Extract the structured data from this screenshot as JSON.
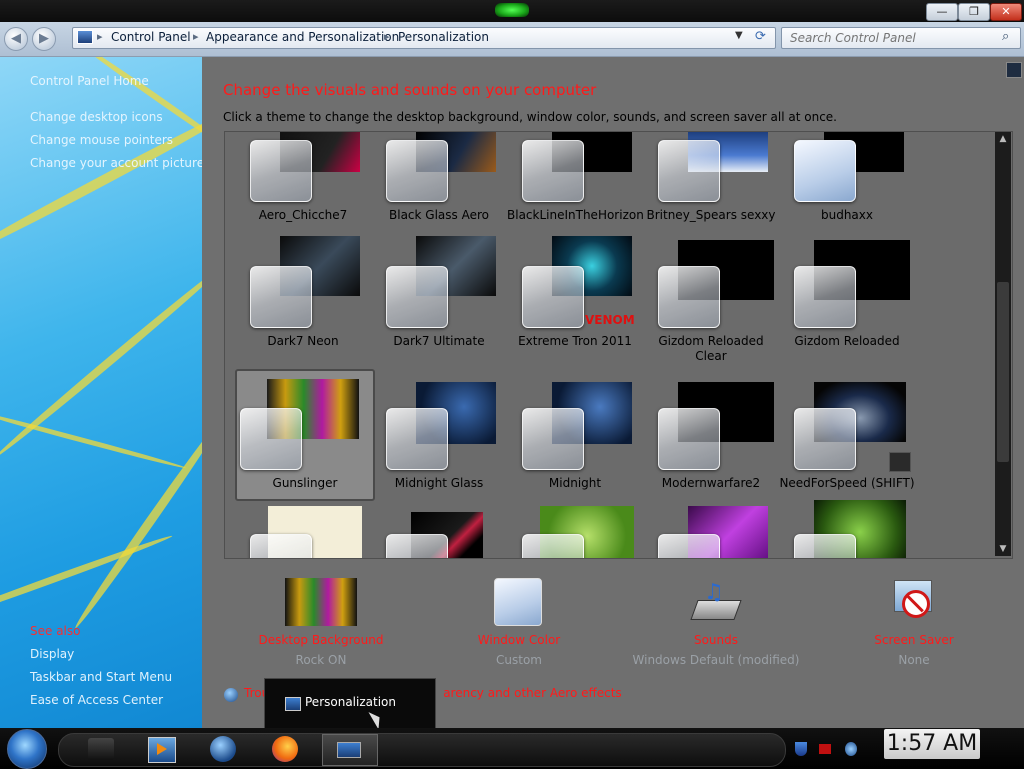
{
  "window": {
    "minimize": "—",
    "restore": "❐",
    "close": "✕"
  },
  "nav": {
    "back": "◀",
    "forward": "▶",
    "breadcrumbs": [
      "Control Panel",
      "Appearance and Personalization",
      "Personalization"
    ],
    "search_placeholder": "Search Control Panel"
  },
  "sidebar": {
    "home": "Control Panel Home",
    "links": [
      "Change desktop icons",
      "Change mouse pointers",
      "Change your account picture"
    ],
    "see_also_title": "See also",
    "see_also": [
      "Display",
      "Taskbar and Start Menu",
      "Ease of Access Center"
    ]
  },
  "main": {
    "title": "Change the visuals and sounds on your computer",
    "subtitle": "Click a theme to change the desktop background, window color, sounds, and screen saver all at once."
  },
  "themes": [
    {
      "name": "Aero_Chicche7"
    },
    {
      "name": "Black Glass Aero"
    },
    {
      "name": "BlackLineInTheHorizon"
    },
    {
      "name": "Britney_Spears sexxy"
    },
    {
      "name": "budhaxx"
    },
    {
      "name": "Dark7 Neon"
    },
    {
      "name": "Dark7 Ultimate"
    },
    {
      "name": "Extreme Tron 2011",
      "badge": "VENOM"
    },
    {
      "name": "Gizdom Reloaded Clear"
    },
    {
      "name": "Gizdom Reloaded"
    },
    {
      "name": "Gunslinger",
      "selected": true
    },
    {
      "name": "Midnight Glass"
    },
    {
      "name": "Midnight"
    },
    {
      "name": "Modernwarfare2"
    },
    {
      "name": "NeedForSpeed (SHIFT)"
    },
    {
      "name": ""
    },
    {
      "name": ""
    },
    {
      "name": ""
    },
    {
      "name": ""
    },
    {
      "name": ""
    }
  ],
  "settings": [
    {
      "title": "Desktop Background",
      "value": "Rock ON",
      "icon": "desktop-background-icon"
    },
    {
      "title": "Window Color",
      "value": "Custom",
      "icon": "window-color-icon"
    },
    {
      "title": "Sounds",
      "value": "Windows Default (modified)",
      "icon": "sounds-icon"
    },
    {
      "title": "Screen Saver",
      "value": "None",
      "icon": "screen-saver-icon"
    }
  ],
  "aero_link": {
    "before": "Trou",
    "after": "arency and other Aero effects"
  },
  "tooltip": {
    "label": "Personalization"
  },
  "taskbar": {
    "clock": "1:57 AM"
  }
}
